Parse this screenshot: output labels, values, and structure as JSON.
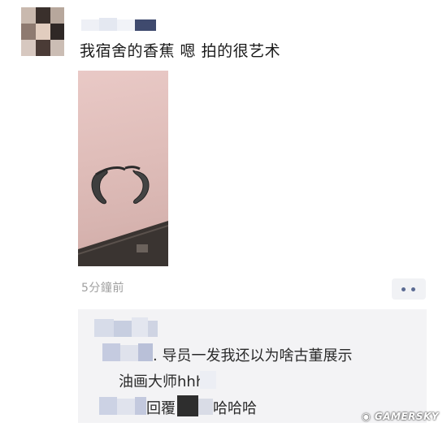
{
  "post": {
    "text": "我宿舍的香蕉 嗯 拍的很艺术",
    "timestamp": "5分鐘前"
  },
  "comments": [
    {
      "text": ". 导员一发我还以为啥古董展示"
    },
    {
      "text": "油画大师hhh"
    },
    {
      "text": "回覆",
      "suffix": "哈哈哈"
    }
  ],
  "watermark": "GAMERSKY",
  "colors": {
    "comment_bg": "#f3f3f5",
    "timestamp": "#a0a0a0",
    "more_dots": "#5b6b93"
  }
}
